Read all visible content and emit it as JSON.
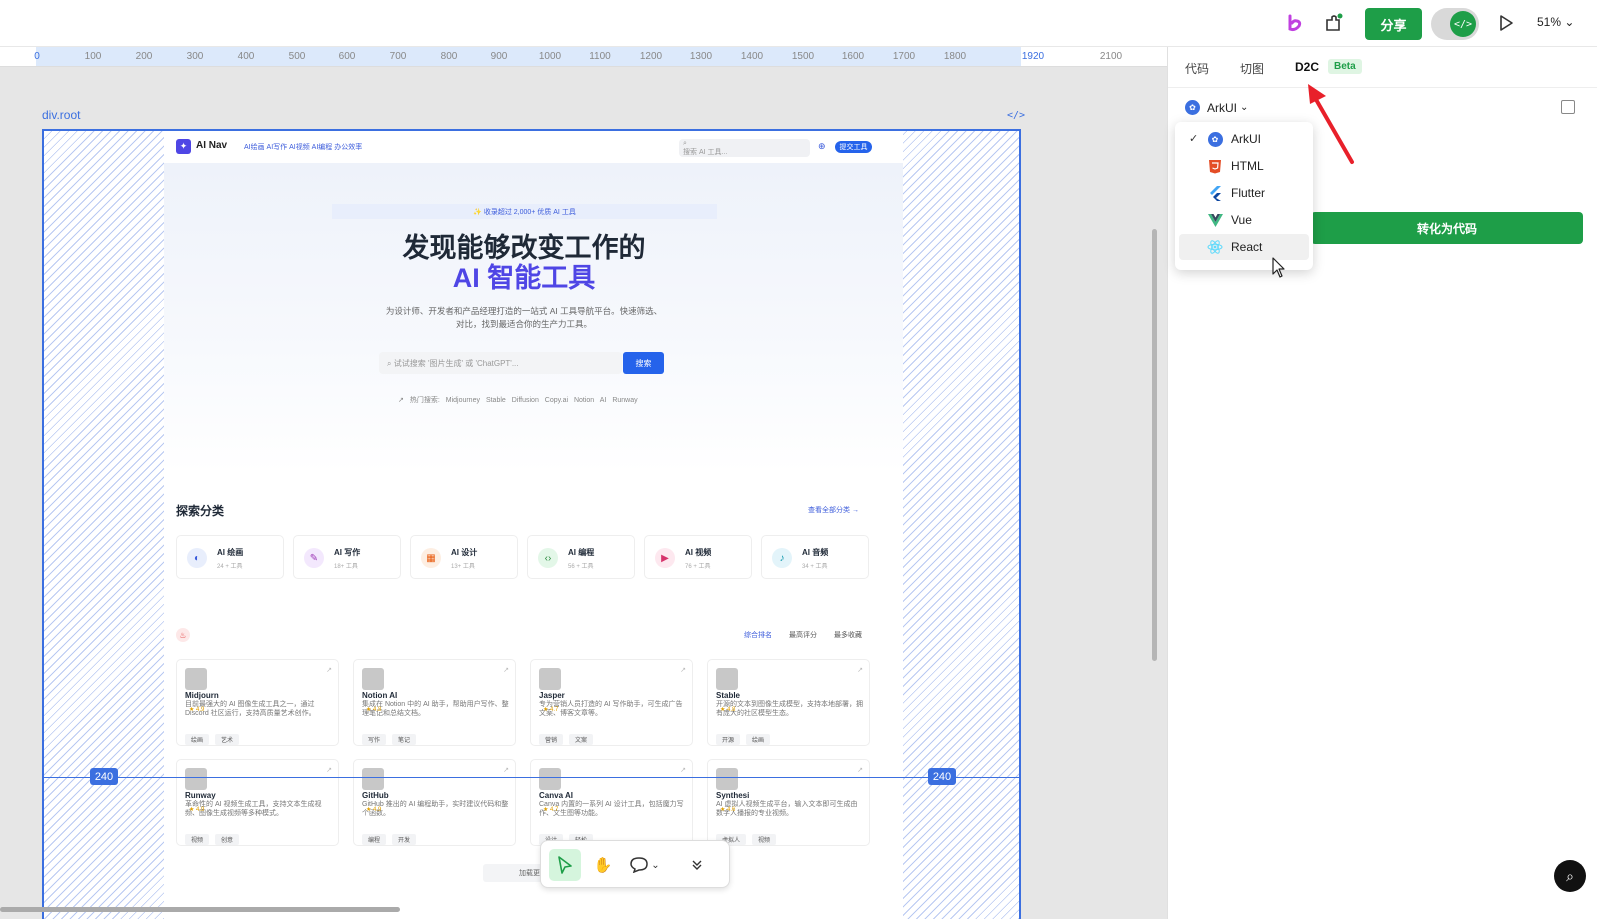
{
  "topbar": {
    "share_label": "分享",
    "zoom": "51%",
    "toggle_icon": "</>"
  },
  "ruler": {
    "ticks": [
      "0",
      "100",
      "200",
      "300",
      "400",
      "500",
      "600",
      "700",
      "800",
      "900",
      "1000",
      "1100",
      "1200",
      "1300",
      "1400",
      "1500",
      "1600",
      "1700",
      "1800",
      "1920",
      "2100"
    ]
  },
  "canvas": {
    "root_label": "div.root",
    "code_mark": "</>",
    "margin_left": "240",
    "margin_right": "240"
  },
  "site": {
    "logo": "AI Nav",
    "nav_links": "AI绘画 AI写作 AI视频 AI编程 办公效率",
    "search_placeholder": "搜索 AI 工具...",
    "submit_label": "提交工具",
    "banner": "✨ 收录超过 2,000+ 优质 AI 工具",
    "headline_1": "发现能够改变工作的",
    "headline_2": "AI 智能工具",
    "subtitle": "为设计师、开发者和产品经理打造的一站式 AI 工具导航平台。快速筛选、对比，找到最适合你的生产力工具。",
    "hero_search_placeholder": "试试搜索 '图片生成' 或 'ChatGPT'...",
    "hero_search_button": "搜索",
    "hot_label": "热门搜索:",
    "hot_terms": [
      "Midjourney",
      "Stable Diffusion",
      "Copy.ai",
      "Notion AI",
      "Runway"
    ],
    "section_title": "探索分类",
    "view_all": "查看全部分类 →",
    "categories": [
      {
        "name": "AI 绘画",
        "count": "24 + 工具"
      },
      {
        "name": "AI 写作",
        "count": "18+ 工具"
      },
      {
        "name": "AI 设计",
        "count": "13+ 工具"
      },
      {
        "name": "AI 编程",
        "count": "56 + 工具"
      },
      {
        "name": "AI 视频",
        "count": "76 + 工具"
      },
      {
        "name": "AI 音频",
        "count": "34 + 工具"
      }
    ],
    "rank_tabs": [
      "综合排名",
      "最高评分",
      "最多收藏"
    ],
    "tools": [
      {
        "name": "Midjourn",
        "desc": "目前最强大的 AI 图像生成工具之一，通过 Discord 社区运行，支持高质量艺术创作。",
        "rating": "★ 4.9",
        "tags": [
          "绘画",
          "艺术"
        ]
      },
      {
        "name": "Notion AI",
        "desc": "集成在 Notion 中的 AI 助手，帮助用户写作、整理笔记和总结文档。",
        "rating": "★ 4.8",
        "tags": [
          "写作",
          "笔记"
        ]
      },
      {
        "name": "Jasper",
        "desc": "专为营销人员打造的 AI 写作助手，可生成广告文案、博客文章等。",
        "rating": "★ 4.7",
        "tags": [
          "营销",
          "文案"
        ]
      },
      {
        "name": "Stable",
        "desc": "开源的文本到图像生成模型，支持本地部署，拥有庞大的社区模型生态。",
        "rating": "★ 4.8",
        "tags": [
          "开源",
          "绘画"
        ]
      },
      {
        "name": "Runway",
        "desc": "革命性的 AI 视频生成工具，支持文本生成视频、图像生成视频等多种模式。",
        "rating": "★ 4.9",
        "tags": [
          "视频",
          "创意"
        ]
      },
      {
        "name": "GitHub",
        "desc": "GitHub 推出的 AI 编程助手，实时建议代码和整个函数。",
        "rating": "★ 4.9",
        "tags": [
          "编程",
          "开发"
        ]
      },
      {
        "name": "Canva AI",
        "desc": "Canva 内置的一系列 AI 设计工具，包括魔力写作、文生图等功能。",
        "rating": "★ 4.7",
        "tags": [
          "设计",
          "轻松"
        ]
      },
      {
        "name": "Synthesi",
        "desc": "AI 虚拟人视频生成平台，输入文本即可生成由数字人播报的专业视频。",
        "rating": "★ 4.6",
        "tags": [
          "虚拟人",
          "视频"
        ]
      }
    ],
    "load_more": "加载更多"
  },
  "panel": {
    "tabs": [
      "代码",
      "切图",
      "D2C"
    ],
    "beta": "Beta",
    "framework_selected": "ArkUI",
    "convert_label": "转化为代码",
    "frameworks": [
      {
        "name": "ArkUI",
        "icon": "arkui-icon",
        "color": "#3b6fe0",
        "checked": true
      },
      {
        "name": "HTML",
        "icon": "html5-icon",
        "color": "#e44d26",
        "checked": false
      },
      {
        "name": "Flutter",
        "icon": "flutter-icon",
        "color": "#42a5f5",
        "checked": false
      },
      {
        "name": "Vue",
        "icon": "vue-icon",
        "color": "#41b883",
        "checked": false
      },
      {
        "name": "React",
        "icon": "react-icon",
        "color": "#61dafb",
        "checked": false
      }
    ]
  },
  "colors": {
    "accent_green": "#1e9e48",
    "selection_blue": "#3b6fe0",
    "annotation_red": "#e8202a"
  }
}
